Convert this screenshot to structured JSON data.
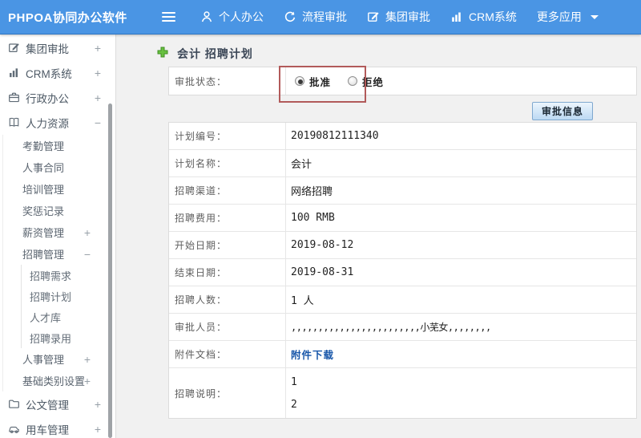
{
  "colors": {
    "topbar_blue": "#4a95e4",
    "annotation_red": "#b25a5a",
    "link_blue": "#1756a9",
    "plus_green": "#68c040",
    "button_face": "#bcd9f3"
  },
  "topbar": {
    "logo": "PHPOA协同办公软件",
    "nav": [
      {
        "label": "个人办公",
        "icon": "user-icon"
      },
      {
        "label": "流程审批",
        "icon": "process-icon"
      },
      {
        "label": "集团审批",
        "icon": "edit-icon"
      },
      {
        "label": "CRM系统",
        "icon": "chart-icon"
      },
      {
        "label": "更多应用",
        "icon": "caret-down-icon"
      }
    ]
  },
  "sidebar": {
    "items": [
      {
        "label": "集团审批",
        "toggle": "+",
        "level": 1,
        "icon": "edit-icon"
      },
      {
        "label": "CRM系统",
        "toggle": "+",
        "level": 1,
        "icon": "chart-icon"
      },
      {
        "label": "行政办公",
        "toggle": "+",
        "level": 1,
        "icon": "briefcase-icon"
      },
      {
        "label": "人力资源",
        "toggle": "−",
        "level": 1,
        "icon": "book-icon"
      },
      {
        "label": "考勤管理",
        "level": 2
      },
      {
        "label": "人事合同",
        "level": 2
      },
      {
        "label": "培训管理",
        "level": 2
      },
      {
        "label": "奖惩记录",
        "level": 2
      },
      {
        "label": "薪资管理",
        "toggle": "+",
        "level": 2
      },
      {
        "label": "招聘管理",
        "toggle": "−",
        "level": 2
      },
      {
        "label": "招聘需求",
        "level": 3
      },
      {
        "label": "招聘计划",
        "level": 3
      },
      {
        "label": "人才库",
        "level": 3
      },
      {
        "label": "招聘录用",
        "level": 3
      },
      {
        "label": "人事管理",
        "toggle": "+",
        "level": 2
      },
      {
        "label": "基础类别设置",
        "toggle": "+",
        "level": 2
      },
      {
        "label": "公文管理",
        "toggle": "+",
        "level": 1,
        "icon": "document-icon"
      },
      {
        "label": "用车管理",
        "toggle": "+",
        "level": 1,
        "icon": "car-icon"
      }
    ]
  },
  "main": {
    "title": "会计 招聘计划",
    "form": {
      "status": {
        "label": "审批状态：",
        "options": [
          {
            "label": "批准",
            "selected": true
          },
          {
            "label": "拒绝",
            "selected": false
          }
        ]
      },
      "approve_info_button": "审批信息",
      "rows": [
        {
          "label": "计划编号：",
          "value": "20190812111340"
        },
        {
          "label": "计划名称：",
          "value": "会计"
        },
        {
          "label": "招聘渠道：",
          "value": "网络招聘"
        },
        {
          "label": "招聘费用：",
          "value": "100 RMB"
        },
        {
          "label": "开始日期：",
          "value": "2019-08-12"
        },
        {
          "label": "结束日期：",
          "value": "2019-08-31"
        },
        {
          "label": "招聘人数：",
          "value": "1 人"
        },
        {
          "label": "审批人员：",
          "value": ",,,,,,,,,,,,,,,,,,,,,,,,小芜女,,,,,,,,"
        }
      ],
      "attachment": {
        "label": "附件文档：",
        "link_text": "附件下载"
      },
      "description": {
        "label": "招聘说明：",
        "lines": [
          "1",
          "2"
        ]
      }
    }
  }
}
